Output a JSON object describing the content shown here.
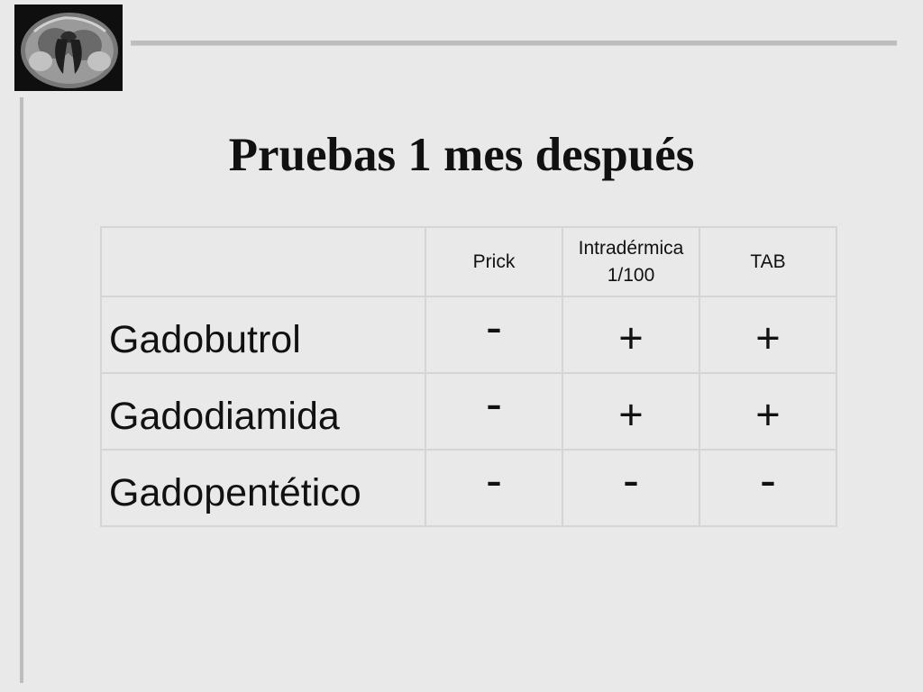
{
  "slide": {
    "title": "Pruebas 1 mes después"
  },
  "thumbnail": {
    "icon": "brain-mri-scan-icon"
  },
  "table": {
    "columns": [
      "",
      "Prick",
      "Intradérmica",
      "TAB"
    ],
    "column_subtitles": [
      "",
      "",
      "1/100",
      ""
    ],
    "rows": [
      {
        "label": "Gadobutrol",
        "results": [
          "-",
          "+",
          "+"
        ]
      },
      {
        "label": "Gadodiamida",
        "results": [
          "-",
          "+",
          "+"
        ]
      },
      {
        "label": "Gadopentético",
        "results": [
          "-",
          "-",
          "-"
        ]
      }
    ]
  },
  "colors": {
    "background": "#e9e9e9",
    "rule": "#bdbdbd",
    "table_border": "#d5d5d5"
  }
}
